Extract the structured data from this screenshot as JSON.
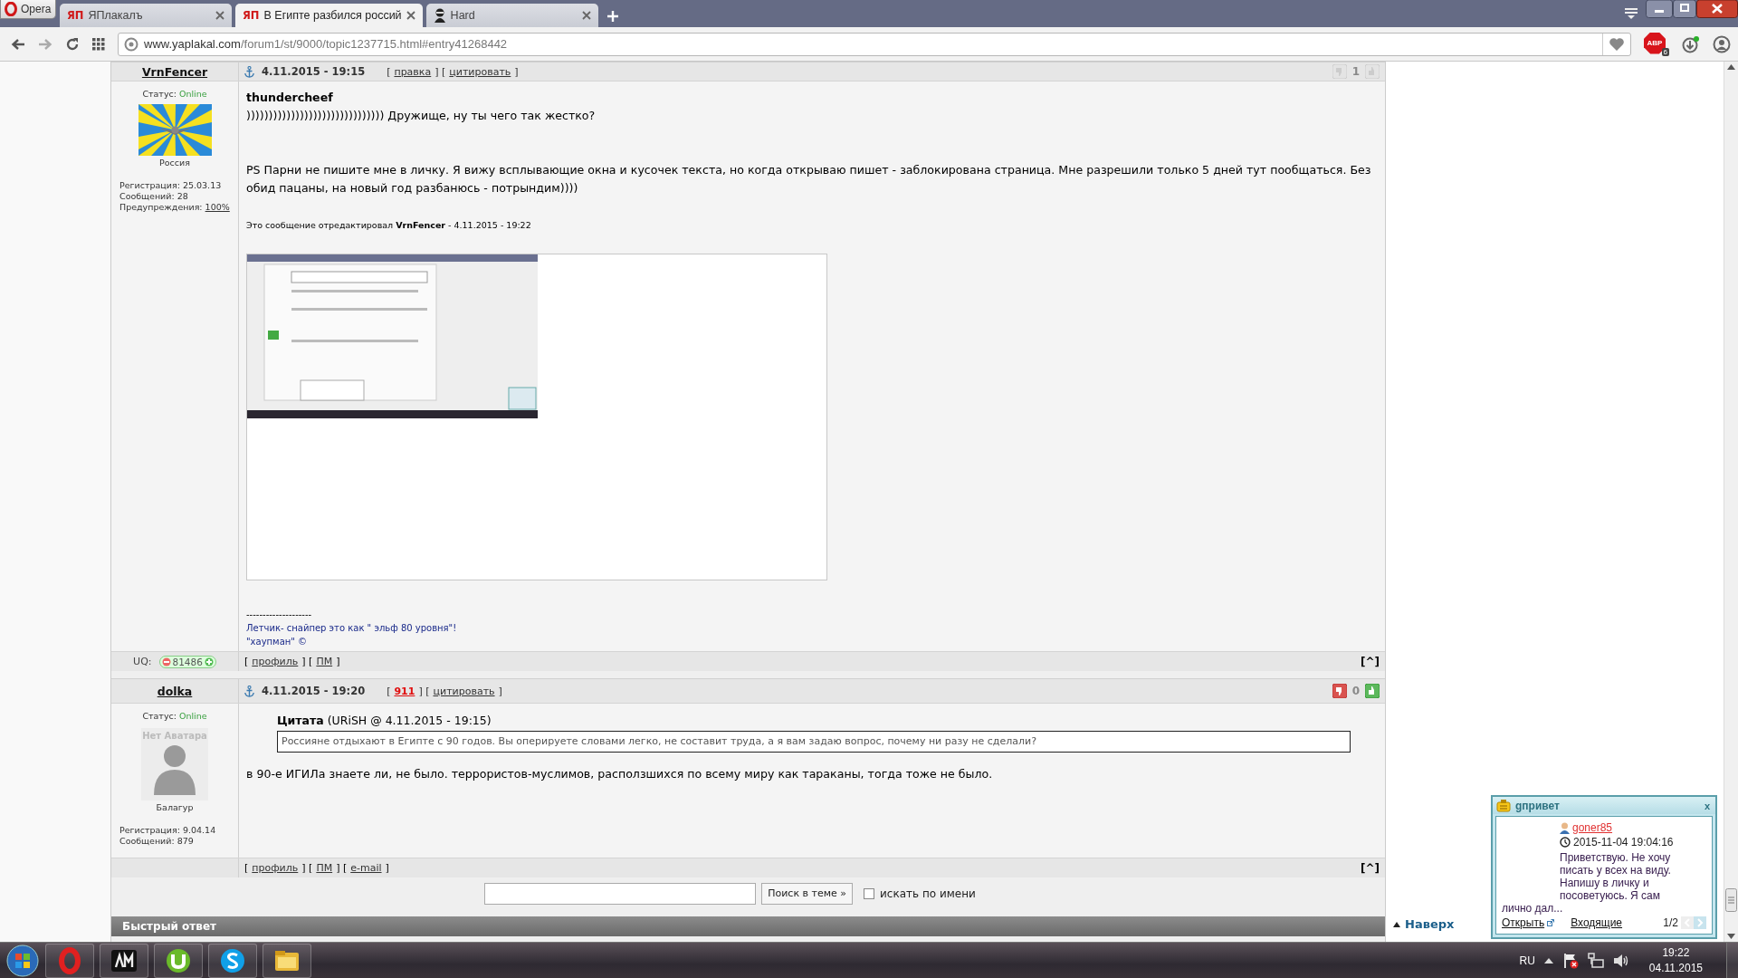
{
  "browser": {
    "menu_label": "Opera",
    "tabs": [
      {
        "label": "ЯПлакалъ",
        "badge": "ЯП",
        "kind": "site",
        "selected": false
      },
      {
        "label": "В Египте разбился россий",
        "badge": "ЯП",
        "kind": "site",
        "selected": true
      },
      {
        "label": "Hard",
        "kind": "user",
        "selected": false
      }
    ],
    "url": {
      "host": "www.yaplakal.com",
      "path": "/forum1/st/9000/topic1237715.html#entry41268442"
    },
    "adblock": {
      "label": "ABP",
      "count": "6"
    }
  },
  "posts": [
    {
      "author": "VrnFencer",
      "date": "4.11.2015 - 19:15",
      "actions": [
        {
          "kind": "text",
          "text": "["
        },
        {
          "kind": "link",
          "text": "правка"
        },
        {
          "kind": "text",
          "text": "] ["
        },
        {
          "kind": "link",
          "text": "цитировать"
        },
        {
          "kind": "text",
          "text": "]"
        }
      ],
      "votes": {
        "count": "1",
        "enabled": false
      },
      "status_label": "Статус:",
      "status": "Online",
      "avatar": {
        "kind": "flag"
      },
      "rank": "Россия",
      "stats": [
        {
          "kind": "text",
          "label": "Регистрация: 25.03.13"
        },
        {
          "kind": "text",
          "label": "Сообщений: 28"
        },
        {
          "kind": "link",
          "label": "Предупреждения:",
          "value": "100%"
        }
      ],
      "body": [
        {
          "kind": "addressee",
          "text": "thundercheef"
        },
        {
          "kind": "line",
          "text": "))))))))))))))))))))))))))))))) Дружище, ну ты чего так жестко?"
        },
        {
          "kind": "paragraph",
          "text": "PS Парни не пишите мне в личку. Я вижу всплывающие окна и кусочек текста, но когда открываю пишет - заблокирована страница. Мне разрешили только 5 дней тут пообщаться. Без обид пацаны, на новый год разбанюсь - потрындим))))"
        }
      ],
      "edited": "Это сообщение отредактировал **VrnFencer** - 4.11.2015 - 19:22",
      "signature": {
        "divider": "--------------------",
        "lines": [
          "Летчик- снайпер это как \" эльф 80 уровня\"!",
          "\"хаупман\" ©"
        ]
      },
      "uq": {
        "label": "UQ:",
        "value": "81486"
      },
      "footer": [
        {
          "kind": "text",
          "text": "["
        },
        {
          "kind": "link",
          "text": "профиль"
        },
        {
          "kind": "text",
          "text": "] ["
        },
        {
          "kind": "link",
          "text": "ПМ"
        },
        {
          "kind": "text",
          "text": "]"
        }
      ],
      "top_link": "[^]"
    },
    {
      "author": "dolka",
      "date": "4.11.2015 - 19:20",
      "actions": [
        {
          "kind": "text",
          "text": "["
        },
        {
          "kind": "alert",
          "text": "911"
        },
        {
          "kind": "text",
          "text": "] ["
        },
        {
          "kind": "link",
          "text": "цитировать"
        },
        {
          "kind": "text",
          "text": "]"
        }
      ],
      "votes": {
        "count": "0",
        "enabled": true
      },
      "status_label": "Статус:",
      "status": "Online",
      "avatar": {
        "kind": "none",
        "caption": "Нет Аватара"
      },
      "rank": "Балагур",
      "stats": [
        {
          "kind": "text",
          "label": "Регистрация: 9.04.14"
        },
        {
          "kind": "text",
          "label": "Сообщений: 879"
        }
      ],
      "quote": {
        "source": "**Цитата** (URiSH @ 4.11.2015 - 19:15)",
        "text": "Россияне отдыхают в Египте с 90 годов. Вы оперируете словами легко, не составит труда, а я вам задаю вопрос, почему ни разу не сделали?"
      },
      "body": [
        {
          "kind": "paragraph",
          "text": "в 90-е ИГИЛа знаете ли, не было. террористов-муслимов, расползшихся по всему миру как тараканы, тогда тоже не было."
        }
      ],
      "footer": [
        {
          "kind": "text",
          "text": "["
        },
        {
          "kind": "link",
          "text": "профиль"
        },
        {
          "kind": "text",
          "text": "] ["
        },
        {
          "kind": "link",
          "text": "ПМ"
        },
        {
          "kind": "text",
          "text": "] ["
        },
        {
          "kind": "link",
          "text": "e-mail"
        },
        {
          "kind": "text",
          "text": "]"
        }
      ],
      "top_link": "[^]"
    }
  ],
  "search": {
    "button": "Поиск в теме »",
    "by_name": {
      "label": "искать по имени",
      "checked": false
    }
  },
  "quick_reply": "Быстрый ответ",
  "to_top": "Наверх",
  "pm_popup": {
    "title": "gпривет",
    "close": "x",
    "sender": "goner85",
    "time": "2015-11-04 19:04:16",
    "message": "Приветствую. Не хочу писать у всех на виду. Напишу в личку и посоветуюсь. Я сам лично дал...",
    "open": "Открыть",
    "inbox": "Входящие",
    "pager": "1/2"
  },
  "taskbar": {
    "language": "RU",
    "time": "19:22",
    "date": "04.11.2015"
  }
}
